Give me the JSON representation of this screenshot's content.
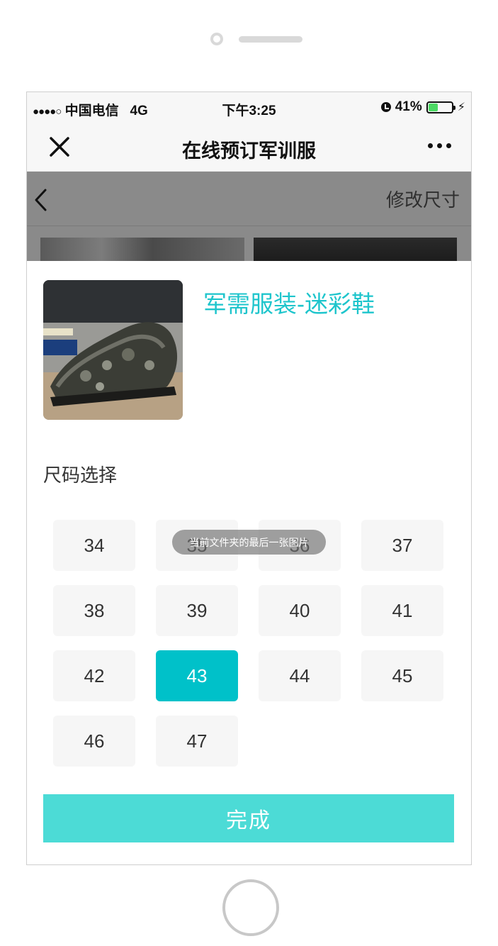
{
  "status_bar": {
    "signal_dots": "●●●●○",
    "carrier": "中国电信",
    "network": "4G",
    "time": "下午3:25",
    "battery_percent": "41%",
    "battery_level": 0.41,
    "battery_color": "#4cd964"
  },
  "nav": {
    "close_icon": "close-icon",
    "title": "在线预订军训服",
    "more_icon": "more-icon"
  },
  "background_page": {
    "back_icon": "chevron-left-icon",
    "edit_size_link": "修改尺寸"
  },
  "product": {
    "title": "军需服装-迷彩鞋",
    "title_color": "#1ec5cc"
  },
  "size_section": {
    "label": "尺码选择",
    "sizes": [
      "34",
      "35",
      "36",
      "37",
      "38",
      "39",
      "40",
      "41",
      "42",
      "43",
      "44",
      "45",
      "46",
      "47"
    ],
    "selected": "43",
    "selected_color": "#00c1c9"
  },
  "toast": {
    "text": "当前文件夹的最后一张图片"
  },
  "done_button": {
    "label": "完成",
    "color": "#4cdbd6"
  }
}
